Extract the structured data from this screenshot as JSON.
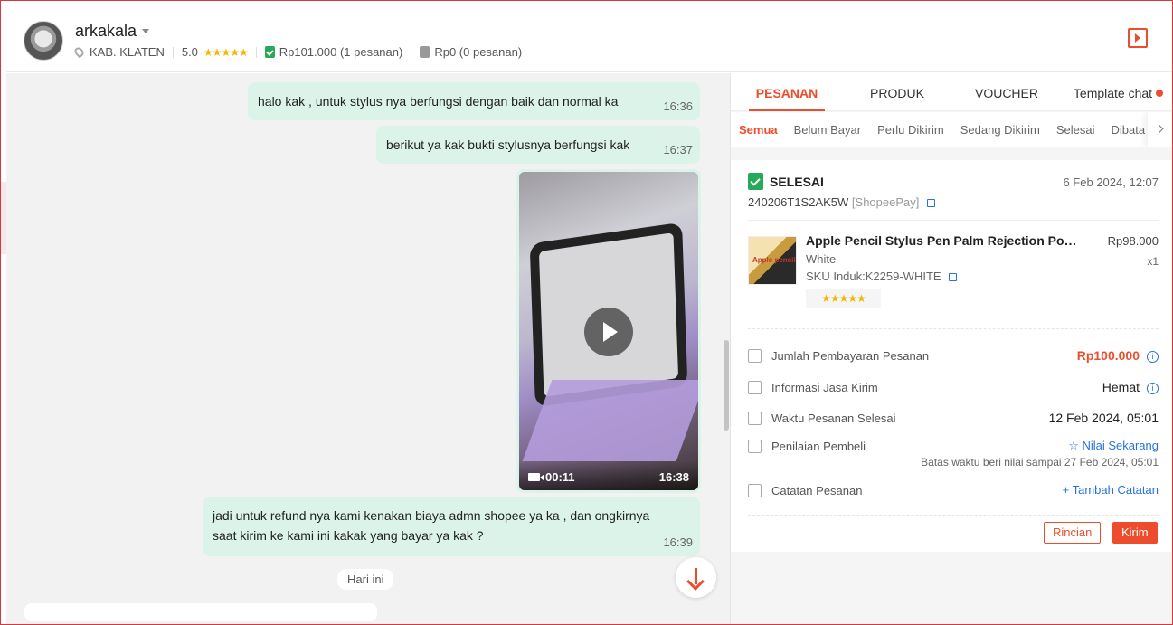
{
  "header": {
    "username": "arkakala",
    "location": "KAB. KLATEN",
    "rating": "5.0",
    "stars": "★★★★★",
    "completed": "Rp101.000 (1 pesanan)",
    "cancelled": "Rp0 (0 pesanan)"
  },
  "chat": {
    "messages": [
      {
        "text": "halo kak ,  untuk stylus nya berfungsi dengan baik dan normal ka",
        "time": "16:36"
      },
      {
        "text": "berikut ya kak bukti stylusnya berfungsi kak",
        "time": "16:37"
      },
      {
        "text": "jadi untuk refund nya kami kenakan biaya admn shopee ya ka , dan ongkirnya saat kirim ke kami ini kakak yang bayar ya kak ?",
        "time": "16:39"
      }
    ],
    "video": {
      "duration": "00:11",
      "time": "16:38"
    },
    "day_chip": "Hari ini"
  },
  "panel": {
    "tabs": [
      "PESANAN",
      "PRODUK",
      "VOUCHER",
      "Template chat"
    ],
    "subtabs": [
      "Semua",
      "Belum Bayar",
      "Perlu Dikirim",
      "Sedang Dikirim",
      "Selesai",
      "Dibata"
    ],
    "order": {
      "status": "SELESAI",
      "date": "6 Feb 2024, 12:07",
      "id": "240206T1S2AK5W",
      "payment": "[ShopeePay]",
      "product": {
        "name": "Apple Pencil Stylus Pen Palm Rejection Power...",
        "price": "Rp98.000",
        "variant": "White",
        "qty": "x1",
        "sku": "SKU Induk:K2259-WHITE",
        "rating": "★★★★★",
        "img_text": "Apple pencil"
      },
      "rows": {
        "payment_label": "Jumlah Pembayaran Pesanan",
        "payment_value": "Rp100.000",
        "shipping_label": "Informasi Jasa Kirim",
        "shipping_value": "Hemat",
        "complete_label": "Waktu Pesanan Selesai",
        "complete_value": "12 Feb 2024, 05:01",
        "review_label": "Penilaian Pembeli",
        "review_value": "☆ Nilai Sekarang",
        "review_deadline": "Batas waktu beri nilai sampai 27 Feb 2024, 05:01",
        "note_label": "Catatan Pesanan",
        "note_value": "+ Tambah Catatan"
      },
      "buttons": {
        "detail": "Rincian",
        "send": "Kirim"
      }
    }
  },
  "colors": {
    "accent": "#ee4d2d",
    "bubble": "#dcf3ea",
    "success": "#26aa5a",
    "link": "#2673dd",
    "star": "#f5b400"
  }
}
